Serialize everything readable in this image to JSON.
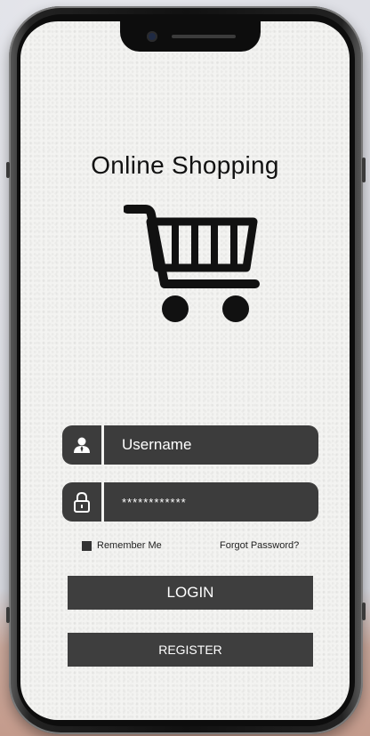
{
  "app": {
    "title": "Online Shopping"
  },
  "login": {
    "username_placeholder": "Username",
    "password_value": "************",
    "remember_label": "Remember Me",
    "remember_checked": true,
    "forgot_label": "Forgot Password?",
    "login_label": "LOGIN",
    "register_label": "REGISTER"
  },
  "icons": {
    "logo": "shopping-cart-icon",
    "username": "user-icon",
    "password": "padlock-icon"
  },
  "colors": {
    "screen_bg": "#f3f3f1",
    "field_bg": "#3c3c3c",
    "button_bg": "#3e3e3e",
    "text_dark": "#111111"
  }
}
